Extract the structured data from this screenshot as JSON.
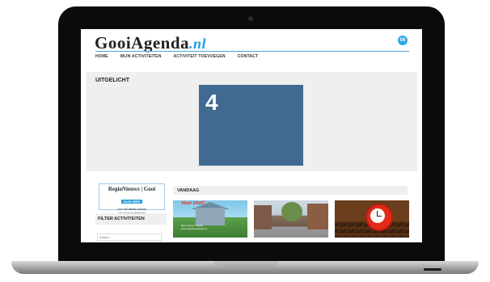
{
  "site": {
    "logo_main": "Gooi",
    "logo_second": "Agenda",
    "logo_tld": ".nl",
    "toggle_label": "08"
  },
  "nav": {
    "items": [
      {
        "label": "HOME"
      },
      {
        "label": "MIJN ACTIVITEITEN"
      },
      {
        "label": "ACTIVITEIT TOEVOEGEN"
      },
      {
        "label": "CONTACT"
      }
    ]
  },
  "featured": {
    "title": "UITGELICHT",
    "card_number": "4",
    "card_color": "#416a92"
  },
  "sidebar": {
    "ad_title": "RegioNieuws | Gooi",
    "ad_button": "KLIK HIER",
    "ad_text_1": "voor het laatste nieuws",
    "ad_text_2": "uit 't Gooi en Eemnes",
    "filter_title": "FILTER ACTIVITEITEN",
    "search_placeholder": "Zoeken..."
  },
  "today": {
    "title": "VANDAAG",
    "thumbs": [
      {
        "caption_title": "Vooi Vooi!",
        "caption_1": "Ben Cramer Theater",
        "caption_2": "www.regionieuwsgooi.nl"
      },
      {
        "icon": "street-photo"
      },
      {
        "icon": "alarm-clock-coffee-photo"
      }
    ]
  },
  "colors": {
    "accent": "#2aa8e6",
    "panel_bg": "#efefef"
  }
}
